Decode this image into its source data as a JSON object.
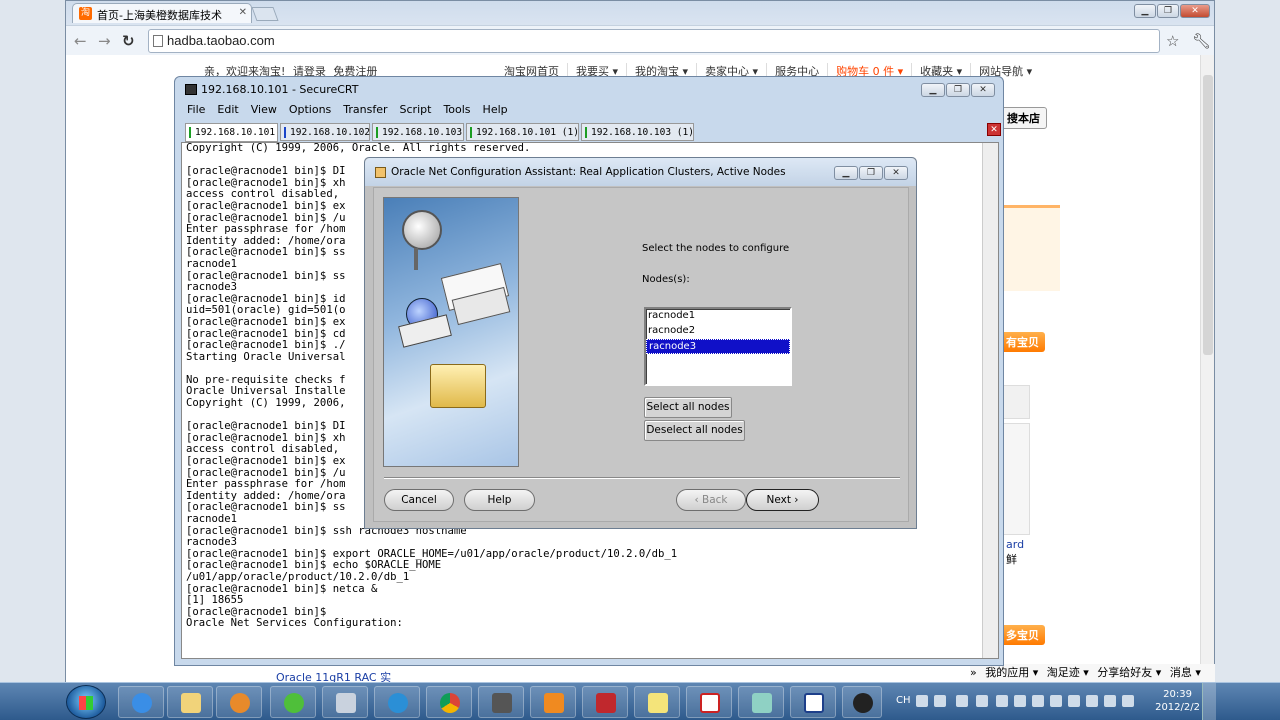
{
  "browser": {
    "tab_title": "首页-上海美橙数据库技术",
    "url": "hadba.taobao.com"
  },
  "taobao": {
    "greeting": "亲，欢迎来淘宝!",
    "login": "请登录",
    "register": "免费注册",
    "links": [
      "淘宝网首页",
      "我要买 ▾",
      "我的淘宝 ▾",
      "卖家中心 ▾",
      "服务中心",
      "购物车 0 件 ▾",
      "收藏夹 ▾",
      "网站导航 ▾"
    ],
    "search_store": "搜本店",
    "all_items": "有宝贝",
    "more_items": "多宝贝",
    "card_text": "ard",
    "fresh_text": "鲜",
    "blog_link": "Oracle 11gR1 RAC 实",
    "status_items": [
      "»",
      "我的应用 ▾",
      "淘足迹 ▾",
      "分享给好友 ▾",
      "消息 ▾"
    ]
  },
  "securecrt": {
    "title": "192.168.10.101 - SecureCRT",
    "menu": [
      "File",
      "Edit",
      "View",
      "Options",
      "Transfer",
      "Script",
      "Tools",
      "Help"
    ],
    "tabs": [
      {
        "label": "192.168.10.101",
        "lamp": "green",
        "active": true
      },
      {
        "label": "192.168.10.102",
        "lamp": "blue",
        "active": false
      },
      {
        "label": "192.168.10.103",
        "lamp": "green",
        "active": false
      },
      {
        "label": "192.168.10.101 (1)",
        "lamp": "green",
        "active": false
      },
      {
        "label": "192.168.10.103 (1)",
        "lamp": "green",
        "active": false
      }
    ],
    "terminal_lines": [
      "Copyright (C) 1999, 2006, Oracle. All rights reserved.",
      "",
      "[oracle@racnode1 bin]$ DI",
      "[oracle@racnode1 bin]$ xh",
      "access control disabled,",
      "[oracle@racnode1 bin]$ ex",
      "[oracle@racnode1 bin]$ /u",
      "Enter passphrase for /hom",
      "Identity added: /home/ora",
      "[oracle@racnode1 bin]$ ss",
      "racnode1",
      "[oracle@racnode1 bin]$ ss",
      "racnode3",
      "[oracle@racnode1 bin]$ id",
      "uid=501(oracle) gid=501(o",
      "[oracle@racnode1 bin]$ ex",
      "[oracle@racnode1 bin]$ cd",
      "[oracle@racnode1 bin]$ ./",
      "Starting Oracle Universal",
      "",
      "No pre-requisite checks f",
      "Oracle Universal Installe",
      "Copyright (C) 1999, 2006,",
      "",
      "[oracle@racnode1 bin]$ DI",
      "[oracle@racnode1 bin]$ xh",
      "access control disabled,",
      "[oracle@racnode1 bin]$ ex",
      "[oracle@racnode1 bin]$ /u",
      "Enter passphrase for /hom",
      "Identity added: /home/ora",
      "[oracle@racnode1 bin]$ ss",
      "racnode1",
      "[oracle@racnode1 bin]$ ssh racnode3 hostname",
      "racnode3",
      "[oracle@racnode1 bin]$ export ORACLE_HOME=/u01/app/oracle/product/10.2.0/db_1",
      "[oracle@racnode1 bin]$ echo $ORACLE_HOME",
      "/u01/app/oracle/product/10.2.0/db_1",
      "[oracle@racnode1 bin]$ netca &",
      "[1] 18655",
      "[oracle@racnode1 bin]$",
      "Oracle Net Services Configuration:"
    ]
  },
  "netca": {
    "title": "Oracle Net Configuration Assistant: Real Application Clusters, Active Nodes",
    "prompt": "Select the nodes to configure",
    "nodes_label": "Nodes(s):",
    "nodes": [
      "racnode1",
      "racnode2",
      "racnode3"
    ],
    "selected_node": "racnode3",
    "select_all": "Select all nodes",
    "deselect_all": "Deselect all nodes",
    "cancel": "Cancel",
    "help": "Help",
    "back": "Back",
    "next": "Next"
  },
  "taskbar": {
    "lang": "CH",
    "time": "20:39",
    "date": "2012/2/2"
  }
}
